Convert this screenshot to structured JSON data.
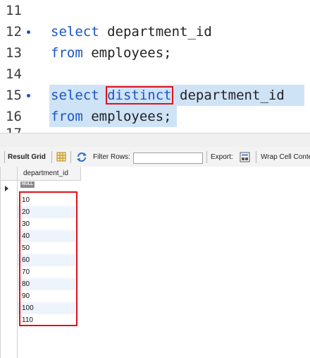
{
  "editor": {
    "lines": [
      {
        "num": "11"
      },
      {
        "num": "12",
        "kw1": "select",
        "rest": " department_id"
      },
      {
        "num": "13",
        "kw1": "from",
        "rest": " employees;"
      },
      {
        "num": "14"
      },
      {
        "num": "15",
        "kw1": "select",
        "kw2": "distinct",
        "rest": " department_id"
      },
      {
        "num": "16",
        "kw1": "from",
        "rest": " employees;"
      }
    ],
    "partial_line_num": "17"
  },
  "toolbar": {
    "result_grid_label": "Result Grid",
    "filter_rows_label": "Filter Rows:",
    "filter_value": "",
    "export_label": "Export:",
    "wrap_label": "Wrap Cell Conte"
  },
  "grid": {
    "column_header": "department_id",
    "null_label": "NULL",
    "rows": [
      "10",
      "20",
      "30",
      "40",
      "50",
      "60",
      "70",
      "80",
      "90",
      "100",
      "110"
    ]
  },
  "colors": {
    "keyword": "#1a55c4",
    "highlight": "#cfe3f7",
    "annotation": "#e0121c"
  }
}
